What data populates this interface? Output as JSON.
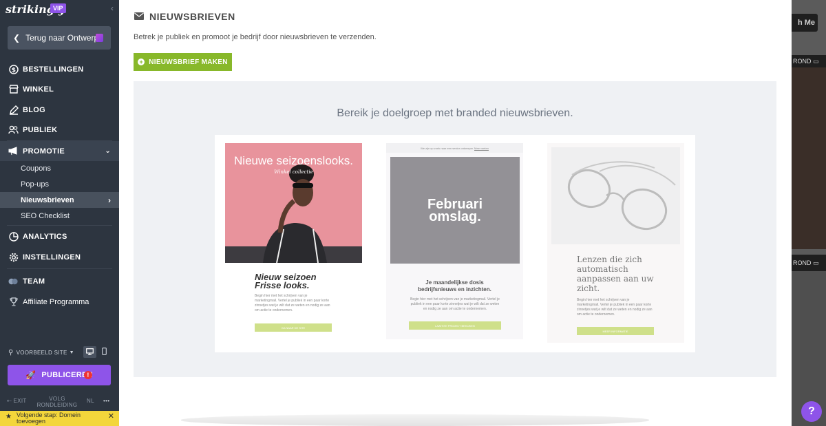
{
  "sidebar": {
    "logo": "strikingly",
    "vip": "VIP",
    "back": "Terug naar Ontwerp",
    "nav": {
      "bestellingen": "BESTELLINGEN",
      "winkel": "WINKEL",
      "blog": "BLOG",
      "publiek": "PUBLIEK",
      "promotie": "PROMOTIE",
      "analytics": "ANALYTICS",
      "instellingen": "INSTELLINGEN",
      "team": "TEAM",
      "affiliate": "Affiliate Programma"
    },
    "promotie_items": [
      "Coupons",
      "Pop-ups",
      "Nieuwsbrieven",
      "SEO Checklist"
    ],
    "preview_label": "VOORBEELD SITE",
    "publish": "PUBLICEREN",
    "footer": {
      "exit": "EXIT",
      "tour_line1": "VOLG",
      "tour_line2": "RONDLEIDING",
      "lang": "NL",
      "more": "•••"
    },
    "next_step_line1": "Volgende stap: Domein",
    "next_step_line2": "toevoegen"
  },
  "editor_bg": {
    "top_button": "h Me",
    "badge1": "ROND",
    "badge2": "ROND"
  },
  "modal": {
    "title": "NIEUWSBRIEVEN",
    "description": "Betrek je publiek en promoot je bedrijf door nieuwsbrieven te verzenden.",
    "create_button": "NIEUWSBRIEF MAKEN",
    "panel_heading": "Bereik je doelgroep met branded nieuwsbrieven.",
    "templates": [
      {
        "headline": "Nieuwe seizoenslooks.",
        "subline": "Winkel collectie",
        "title_line1": "Nieuw seizoen",
        "title_line2": "Frisse looks.",
        "body": "Begin hier met het schrijven van je marketingmail. Vertel je publiek in een paar korte zinnetjes wat je wilt dat ze weten en nodig ze aan om actie te ondernemen.",
        "button": "GA NAAR DE SITE"
      },
      {
        "top_note": "We zijn op zoek naar een senior ontwerper.",
        "top_link": "Meer weten",
        "cover_line1": "Februari",
        "cover_line2": "omslag.",
        "title_line1": "Je maandelijkse dosis",
        "title_line2": "bedrijfsnieuws en inzichten.",
        "body": "Begin hier met het schrijven van je marketingmail. Vertel je publiek in een paar korte zinnetjes wat je wilt dat ze weten en nodig ze aan om actie te ondernemen.",
        "button": "LAATSTE PROJECT BEKIJKEN"
      },
      {
        "title": "Lenzen die zich automatisch aanpassen aan uw zicht.",
        "body": "Begin hier met het schrijven van je marketingmail. Vertel je publiek in een paar korte zinnetjes wat je wilt dat ze weten en nodig ze aan om actie te ondernemen.",
        "button": "MEER INFORMATIE"
      }
    ]
  },
  "help": "?",
  "colors": {
    "sidebar": "#2d3540",
    "purple": "#8e54e9",
    "green": "#88b82a",
    "pink": "#e8939c",
    "gray_cover": "#939196"
  }
}
